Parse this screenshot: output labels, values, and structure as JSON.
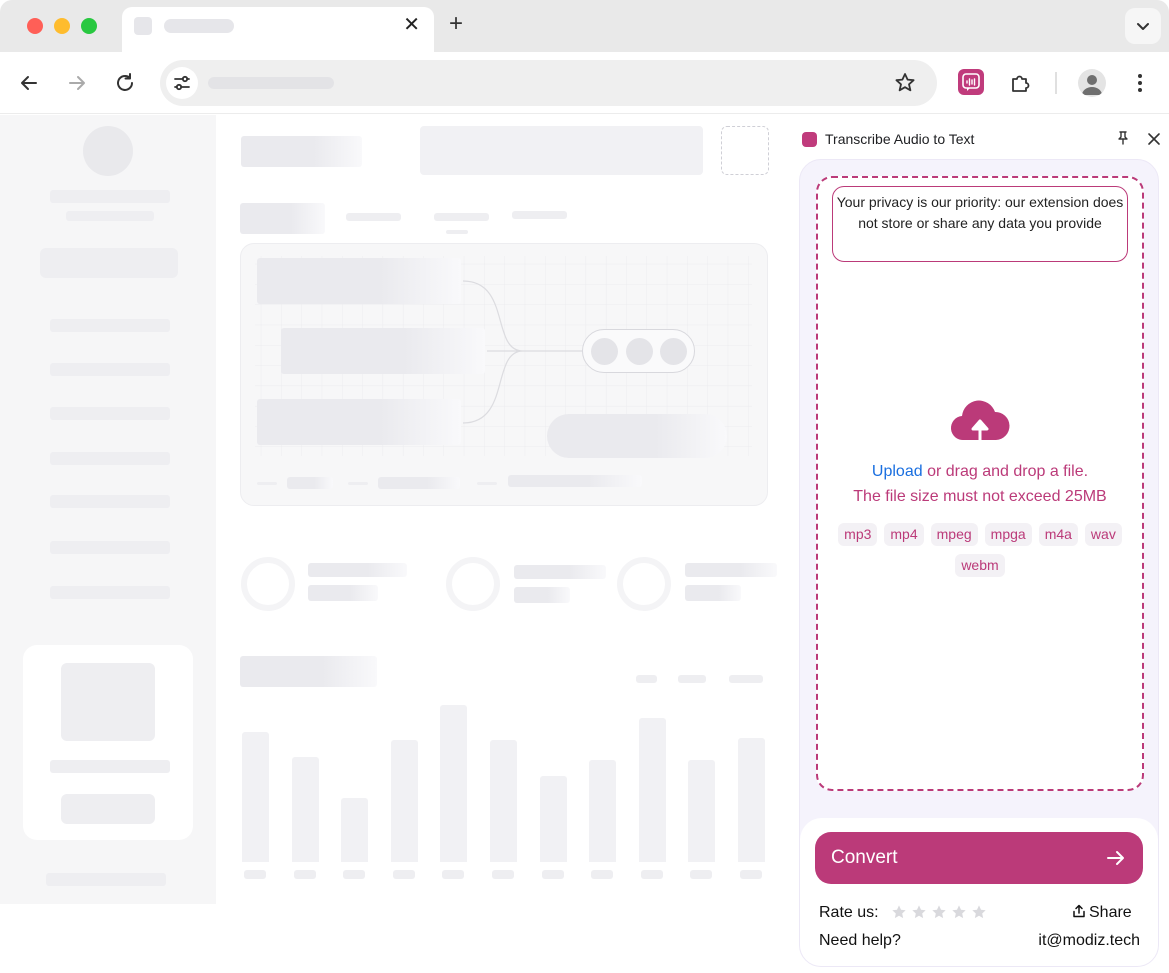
{
  "browser": {
    "tab_close": "✕",
    "new_tab": "+"
  },
  "panel": {
    "title": "Transcribe Audio to Text",
    "privacy_notice": "Your privacy is our priority: our extension does not store or share any data you provide",
    "upload_link": "Upload",
    "upload_rest": " or drag and drop a file.",
    "size_limit": "The file size must not exceed 25MB",
    "formats": [
      "mp3",
      "mp4",
      "mpeg",
      "mpga",
      "m4a",
      "wav",
      "webm"
    ],
    "convert_label": "Convert",
    "rate_label": "Rate us:",
    "rating_stars": 5,
    "share_label": "Share",
    "help_label": "Need help?",
    "help_email": "it@modiz.tech"
  },
  "colors": {
    "accent": "#bb3a79",
    "link": "#1a6fe0",
    "panel_bg": "#f5f3fc"
  },
  "icons": [
    "back-icon",
    "forward-icon",
    "reload-icon",
    "site-settings-icon",
    "bookmark-star-icon",
    "transcribe-extension-icon",
    "puzzle-extensions-icon",
    "profile-icon",
    "kebab-menu-icon",
    "pin-icon",
    "close-icon",
    "cloud-upload-icon",
    "arrow-right-icon",
    "share-icon",
    "star-icon"
  ]
}
